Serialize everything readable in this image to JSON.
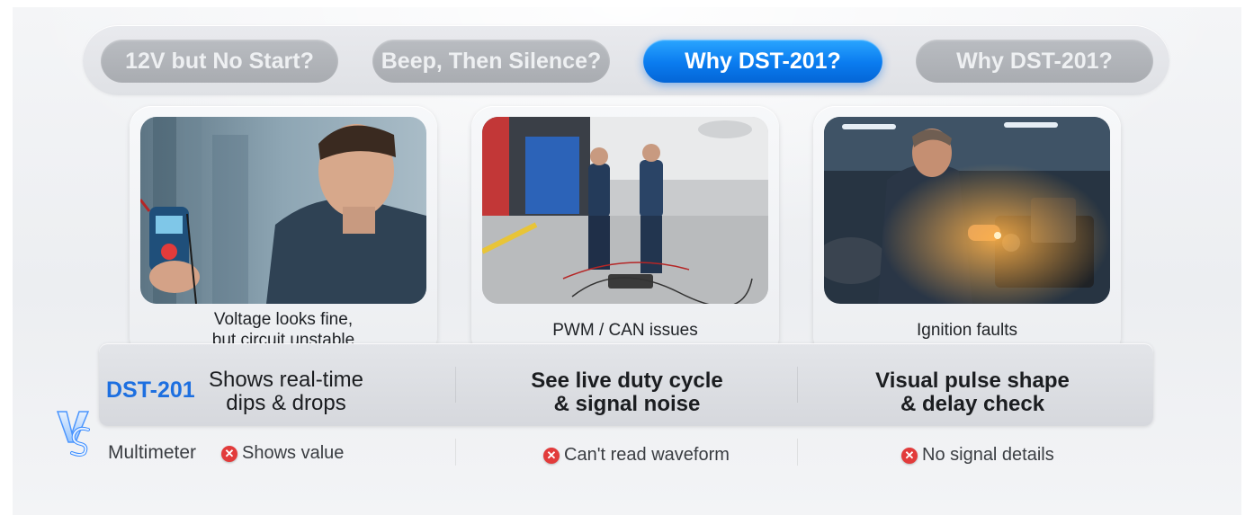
{
  "tabs": [
    {
      "label": "12V but No Start?",
      "active": false
    },
    {
      "label": "Beep, Then Silence?",
      "active": false
    },
    {
      "label": "Why DST-201?",
      "active": true
    },
    {
      "label": "Why DST-201?",
      "active": false
    }
  ],
  "cards": [
    {
      "caption": "Voltage looks fine,\nbut circuit unstable",
      "photo": "technician-with-multimeter-photo"
    },
    {
      "caption": "PWM / CAN issues",
      "photo": "technicians-testing-wiring-photo"
    },
    {
      "caption": "Ignition faults",
      "photo": "mechanic-at-engine-photo"
    }
  ],
  "comparison": {
    "brand_label": "DST-201",
    "vs_label": "VS",
    "dst_features": [
      "Shows real-time\ndips & drops",
      "See live duty cycle\n& signal noise",
      "Visual pulse shape\n& delay check"
    ],
    "multimeter_label": "Multimeter",
    "multimeter_features": [
      "Shows value",
      "Can't read waveform",
      "No signal details"
    ],
    "negative_icon": "red-x-icon"
  },
  "colors": {
    "accent": "#0a7bef",
    "brand_text": "#1d6fe0",
    "inactive_tab": "#aeb1b6",
    "negative": "#e23b3b"
  }
}
